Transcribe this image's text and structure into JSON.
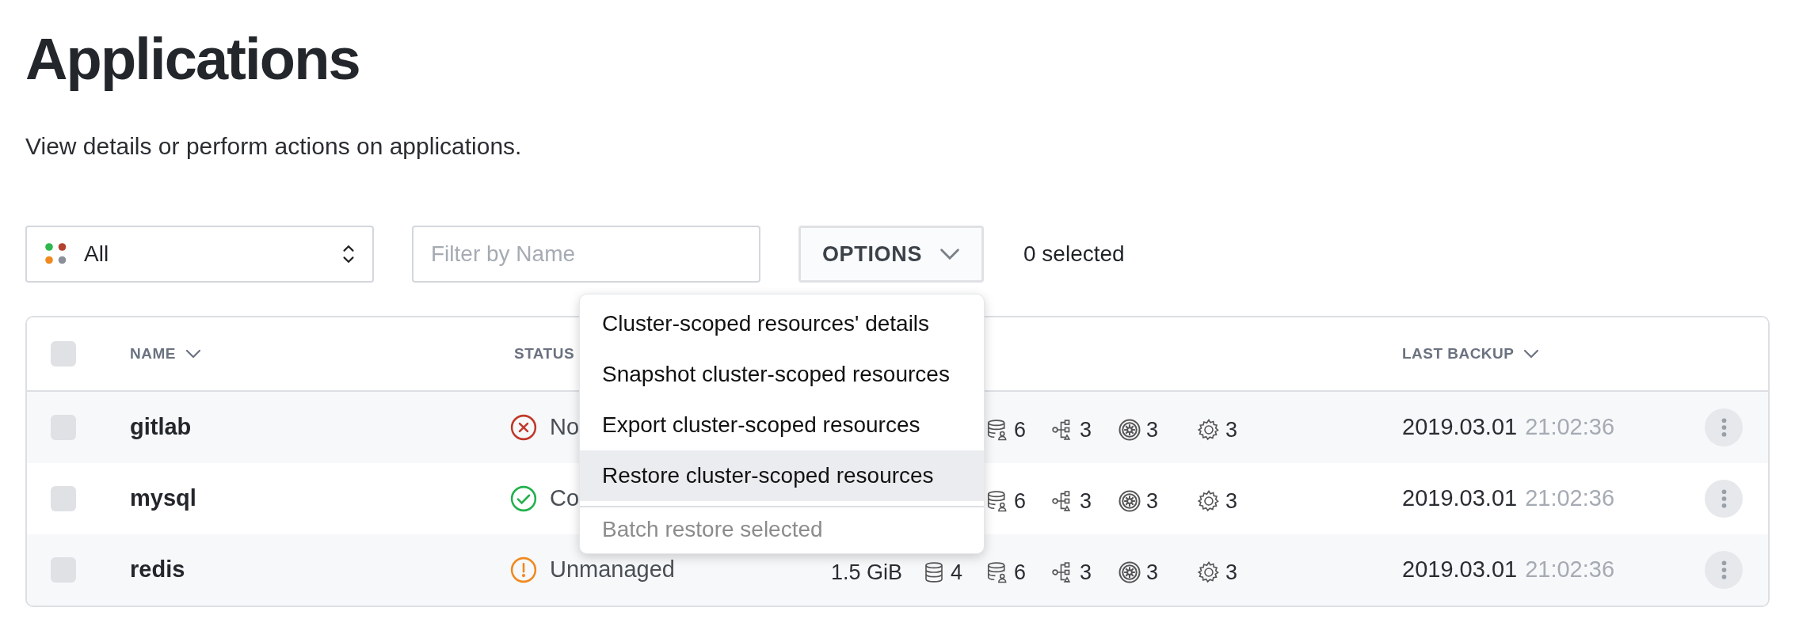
{
  "page": {
    "title": "Applications",
    "subtitle": "View details or perform actions on applications."
  },
  "toolbar": {
    "filter_select": {
      "value": "All"
    },
    "search": {
      "placeholder": "Filter by Name"
    },
    "options_button": {
      "label": "OPTIONS",
      "expanded": true
    },
    "selected_count": "0 selected"
  },
  "options_menu": {
    "groups": [
      [
        {
          "label": "Cluster-scoped resources' details",
          "highlighted": false,
          "disabled": false
        },
        {
          "label": "Snapshot cluster-scoped resources",
          "highlighted": false,
          "disabled": false
        },
        {
          "label": "Export cluster-scoped resources",
          "highlighted": false,
          "disabled": false
        },
        {
          "label": "Restore cluster-scoped resources",
          "highlighted": true,
          "disabled": false
        }
      ],
      [
        {
          "label": "Batch restore selected",
          "highlighted": false,
          "disabled": true
        }
      ]
    ]
  },
  "table": {
    "select_all": {
      "checked": false
    },
    "columns": [
      {
        "label": "NAME",
        "sortable": true
      },
      {
        "label": "STATUS",
        "sortable": false
      },
      {
        "label": "LAST BACKUP",
        "sortable": true
      }
    ],
    "rows": [
      {
        "checked": false,
        "name": "gitlab",
        "status": {
          "kind": "error",
          "text": "No"
        },
        "metrics": [
          {
            "kind": "db-user",
            "count": "6"
          },
          {
            "kind": "topology",
            "count": "3"
          },
          {
            "kind": "helm",
            "count": "3"
          },
          {
            "kind": "gear",
            "count": "3"
          }
        ],
        "backup_date": "2019.03.01",
        "backup_time": "21:02:36"
      },
      {
        "checked": false,
        "name": "mysql",
        "status": {
          "kind": "ok",
          "text": "Co"
        },
        "metrics": [
          {
            "kind": "db-user",
            "count": "6"
          },
          {
            "kind": "topology",
            "count": "3"
          },
          {
            "kind": "helm",
            "count": "3"
          },
          {
            "kind": "gear",
            "count": "3"
          }
        ],
        "backup_date": "2019.03.01",
        "backup_time": "21:02:36"
      },
      {
        "checked": false,
        "name": "redis",
        "status": {
          "kind": "warning",
          "text": "Unmanaged"
        },
        "size": "1.5 GiB",
        "metrics": [
          {
            "kind": "db",
            "count": "4"
          },
          {
            "kind": "db-user",
            "count": "6"
          },
          {
            "kind": "topology",
            "count": "3"
          },
          {
            "kind": "helm",
            "count": "3"
          },
          {
            "kind": "gear",
            "count": "3"
          }
        ],
        "backup_date": "2019.03.01",
        "backup_time": "21:02:36"
      }
    ]
  }
}
